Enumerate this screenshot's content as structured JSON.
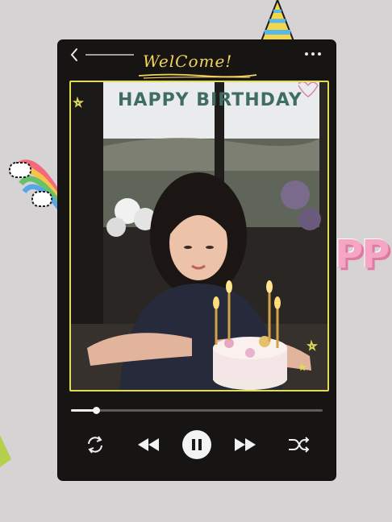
{
  "header": {
    "welcome_text": "WelCome!",
    "back_icon": "chevron-left-icon",
    "more_icon": "more-dots-icon"
  },
  "photo": {
    "banner_text": "HAPPY BIRTHDAY",
    "frame_color": "#e0dc56"
  },
  "player": {
    "progress": 0.1,
    "controls": [
      "repeat-icon",
      "previous-icon",
      "pause-icon",
      "next-icon",
      "shuffle-icon"
    ]
  },
  "decorations": {
    "side_text": "PP",
    "colors": {
      "background": "#d5d3d3",
      "phone": "#171414",
      "accent_yellow": "#f2d35c",
      "pink": "#f5a6c4"
    }
  }
}
